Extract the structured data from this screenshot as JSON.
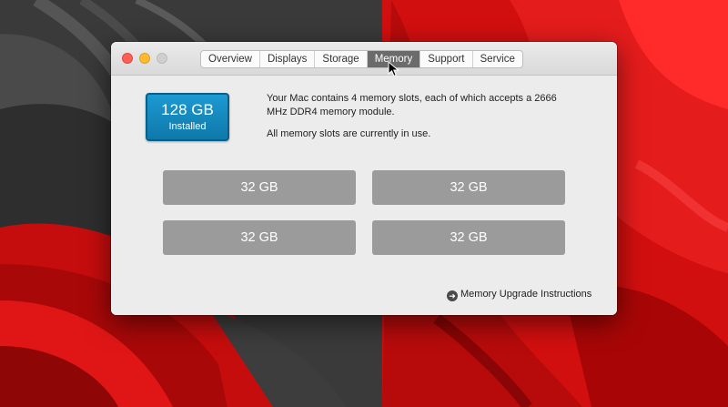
{
  "window": {
    "tabs": [
      "Overview",
      "Displays",
      "Storage",
      "Memory",
      "Support",
      "Service"
    ],
    "active_tab": "Memory"
  },
  "memory": {
    "installed_size": "128 GB",
    "installed_label": "Installed",
    "description_line1": "Your Mac contains 4 memory slots, each of which accepts a 2666 MHz DDR4 memory module.",
    "description_line2": "All memory slots are currently in use.",
    "slots": [
      "32 GB",
      "32 GB",
      "32 GB",
      "32 GB"
    ],
    "upgrade_link": "Memory Upgrade Instructions"
  },
  "colors": {
    "installed_badge": "#1589c0",
    "slot_fill": "#9b9b9b",
    "wallpaper_red": "#d20f0f"
  }
}
